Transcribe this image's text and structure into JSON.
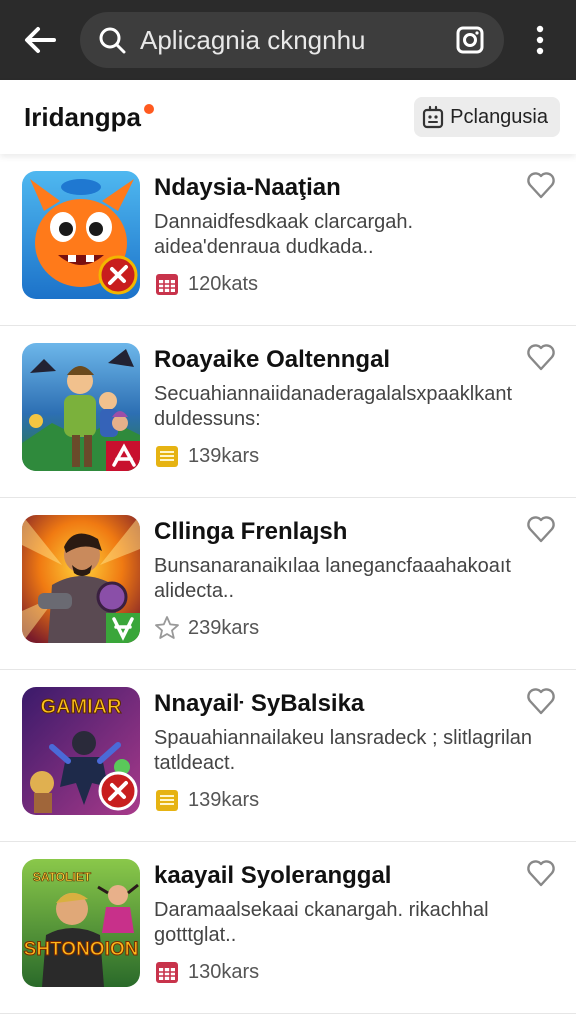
{
  "topbar": {
    "search_value": "Aplicagnia ckngnhu",
    "icons": [
      "back-arrow-icon",
      "search-icon",
      "camera-icon",
      "more-vertical-icon"
    ]
  },
  "header": {
    "title": "Iridangpa",
    "language_button": "Pclangusia",
    "accent": "#ff5a1f"
  },
  "apps": [
    {
      "title": "Ndaysia-Naaţian",
      "description": "Dannaidfesdkaak clarcargah. aidea'denraua dudkada..",
      "meta": "120kats",
      "meta_icon": "calendar-red-icon"
    },
    {
      "title": "Roayaike Oaltenngal",
      "description": "Secuahiannaiidanaderagalalsxpaaklkant duldessuns:",
      "meta": "139kars",
      "meta_icon": "note-yellow-icon"
    },
    {
      "title": "Cllinga Frenlaȷsh",
      "description": "Bunsanaranaikılaa lanegancfaaahakoaıt alidecta..",
      "meta": "239kars",
      "meta_icon": "star-outline-icon"
    },
    {
      "title": "Nnayaiŀ SyBalsika",
      "description": "Spauahiannailakeu lansradeck ; slitlagrilan tatldeact.",
      "meta": "139kars",
      "meta_icon": "note-yellow-icon"
    },
    {
      "title": "kaayail Syoleranggal",
      "description": "Daramaalsekaai ckanargah. rikachhal gotttglat..",
      "meta": "130kars",
      "meta_icon": "calendar-red-icon"
    }
  ],
  "thumb_text": {
    "app4": "GAMIAR",
    "app5_top": "SATOLIET",
    "app5_main": "SHTONOION"
  }
}
